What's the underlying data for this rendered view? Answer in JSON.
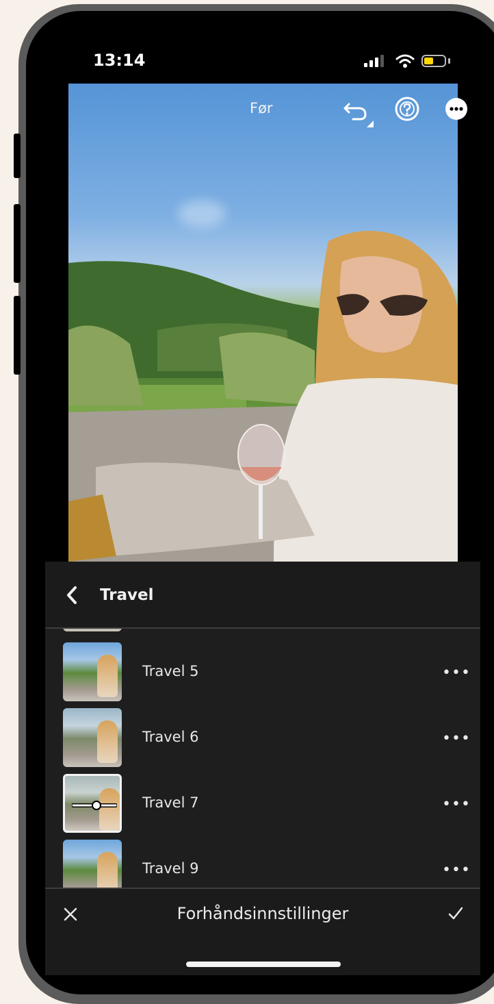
{
  "status": {
    "time": "13:14"
  },
  "editor": {
    "before_label": "Før"
  },
  "panel": {
    "title": "Travel",
    "presets": [
      {
        "label": "Travel 5",
        "selected": false
      },
      {
        "label": "Travel 6",
        "selected": false
      },
      {
        "label": "Travel 7",
        "selected": true
      },
      {
        "label": "Travel 9",
        "selected": false
      }
    ],
    "more_label": "•••"
  },
  "footer": {
    "title": "Forhåndsinnstillinger"
  },
  "colors": {
    "battery": "#ffd60a",
    "panel_bg": "#1e1e1e",
    "page_bg": "#f8f1ea"
  }
}
